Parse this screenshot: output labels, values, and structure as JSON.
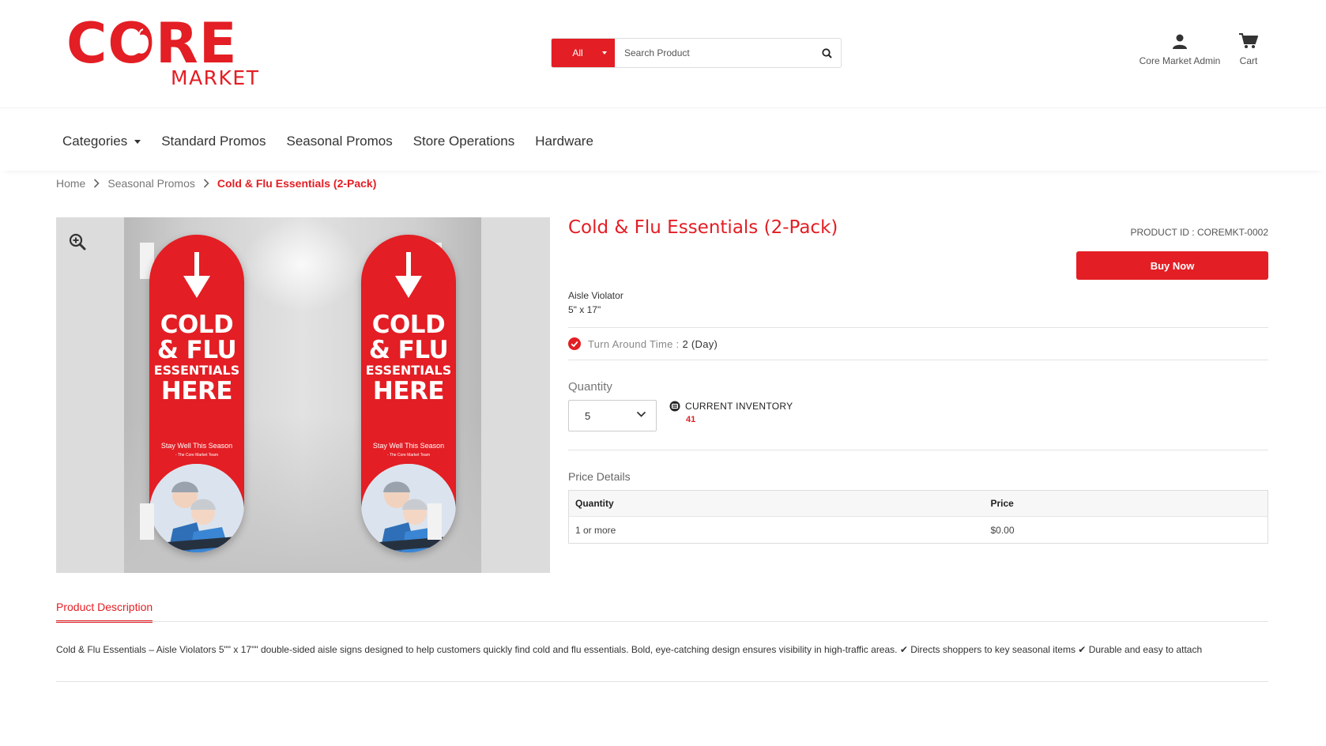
{
  "brand": {
    "logo_main": "CORE",
    "logo_sub": "MARKET",
    "accent_color": "#e31e24"
  },
  "search": {
    "category": "All",
    "placeholder": "Search Product",
    "button_icon": "search-icon"
  },
  "account": {
    "user_label": "Core Market Admin",
    "cart_label": "Cart"
  },
  "nav": {
    "items": [
      {
        "label": "Categories",
        "has_dropdown": true
      },
      {
        "label": "Standard Promos"
      },
      {
        "label": "Seasonal Promos"
      },
      {
        "label": "Store Operations"
      },
      {
        "label": "Hardware"
      }
    ]
  },
  "breadcrumb": {
    "items": [
      "Home",
      "Seasonal Promos"
    ],
    "current": "Cold & Flu Essentials (2-Pack)"
  },
  "gallery": {
    "sign_line1": "COLD",
    "sign_line2": "& FLU",
    "sign_line3": "ESSENTIALS",
    "sign_line4": "HERE",
    "sign_tagline": "Stay Well This Season",
    "sign_team": "- The Core Market Team"
  },
  "product": {
    "title": "Cold & Flu Essentials (2-Pack)",
    "product_id": "PRODUCT ID : COREMKT-0002",
    "buy_label": "Buy Now",
    "type": "Aisle Violator",
    "size": "5\" x 17\"",
    "tat_label": "Turn Around Time :",
    "tat_value": "2 (Day)",
    "quantity_label": "Quantity",
    "quantity_value": "5",
    "inventory_label": "CURRENT INVENTORY",
    "inventory_value": "41"
  },
  "price_details": {
    "label": "Price Details",
    "headers": [
      "Quantity",
      "Price"
    ],
    "rows": [
      [
        "1 or more",
        "$0.00"
      ]
    ]
  },
  "description": {
    "tab_label": "Product Description",
    "text": "Cold & Flu Essentials – Aisle Violators 5\"\" x 17\"\" double-sided aisle signs designed to help customers quickly find cold and flu essentials. Bold, eye-catching design ensures visibility in high-traffic areas. ✔ Directs shoppers to key seasonal items ✔ Durable and easy to attach"
  }
}
